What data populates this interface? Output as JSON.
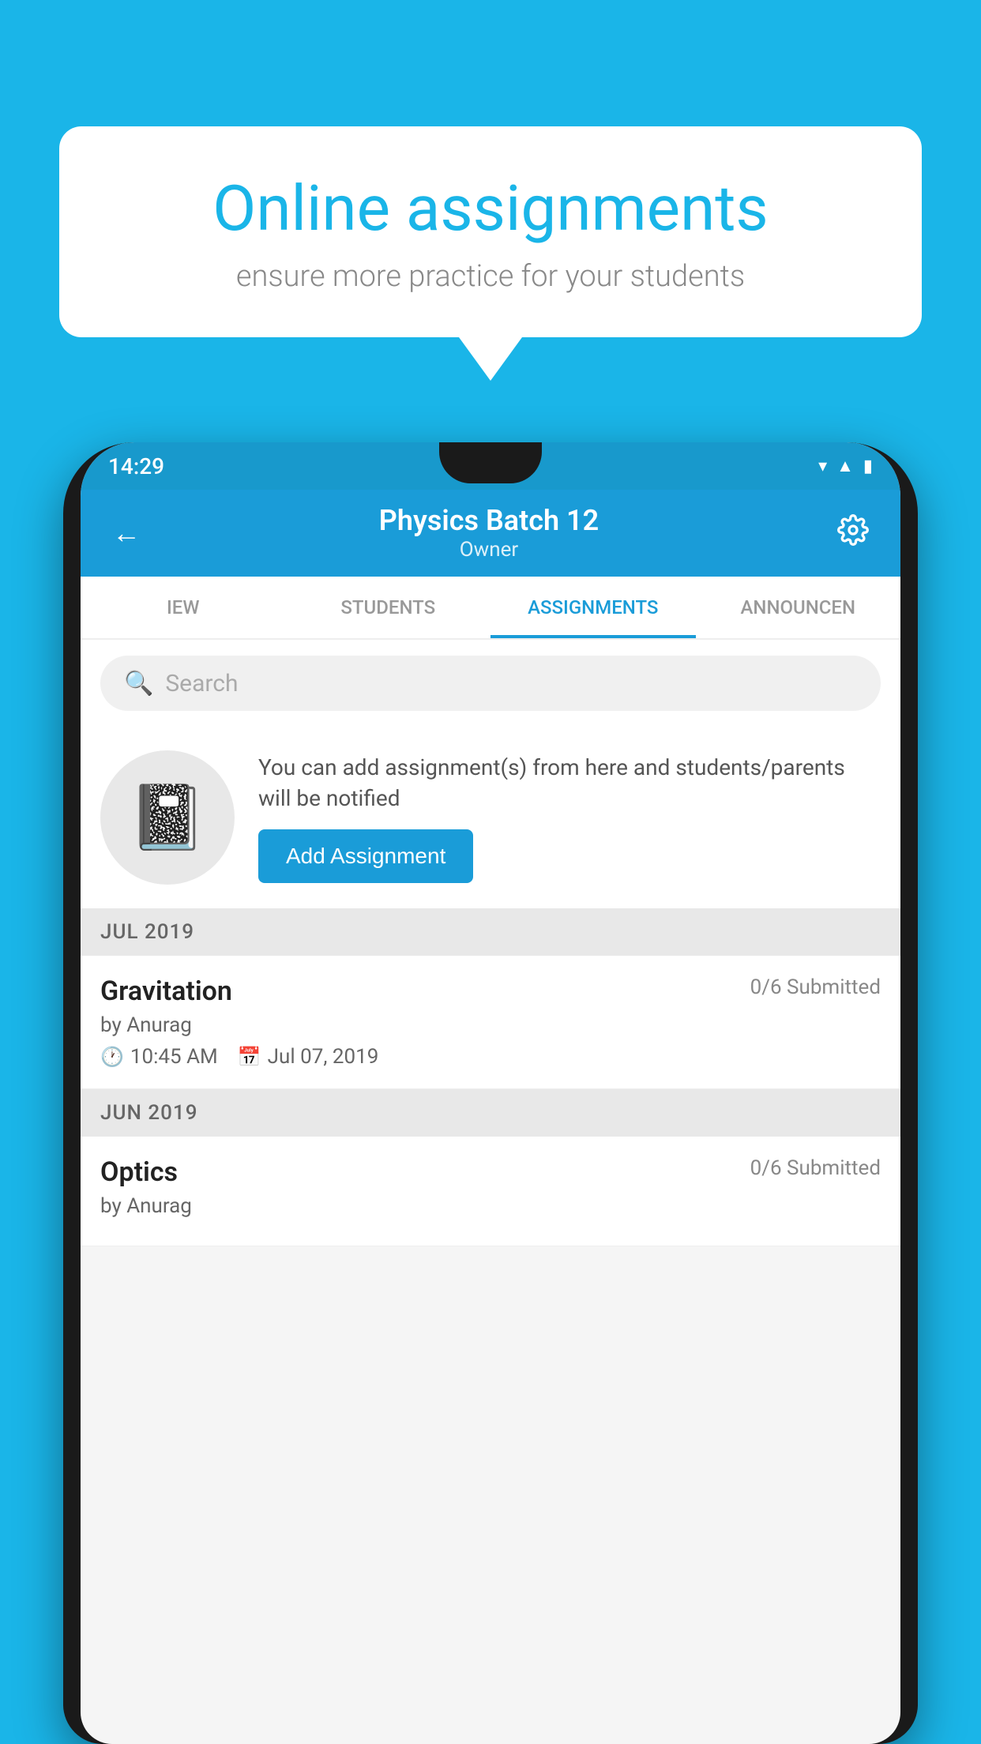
{
  "background_color": "#1ab5e8",
  "speech_bubble": {
    "title": "Online assignments",
    "subtitle": "ensure more practice for your students"
  },
  "phone": {
    "status_bar": {
      "time": "14:29",
      "icons": [
        "wifi",
        "signal",
        "battery"
      ]
    },
    "app_bar": {
      "title": "Physics Batch 12",
      "subtitle": "Owner",
      "back_label": "←",
      "settings_label": "⚙"
    },
    "tabs": [
      {
        "label": "IEW",
        "active": false
      },
      {
        "label": "STUDENTS",
        "active": false
      },
      {
        "label": "ASSIGNMENTS",
        "active": true
      },
      {
        "label": "ANNOUNCEN",
        "active": false
      }
    ],
    "search": {
      "placeholder": "Search"
    },
    "promo": {
      "text": "You can add assignment(s) from here and students/parents will be notified",
      "button_label": "Add Assignment"
    },
    "sections": [
      {
        "label": "JUL 2019",
        "assignments": [
          {
            "name": "Gravitation",
            "submitted": "0/6 Submitted",
            "by": "by Anurag",
            "time": "10:45 AM",
            "date": "Jul 07, 2019"
          }
        ]
      },
      {
        "label": "JUN 2019",
        "assignments": [
          {
            "name": "Optics",
            "submitted": "0/6 Submitted",
            "by": "by Anurag",
            "time": "",
            "date": ""
          }
        ]
      }
    ]
  }
}
